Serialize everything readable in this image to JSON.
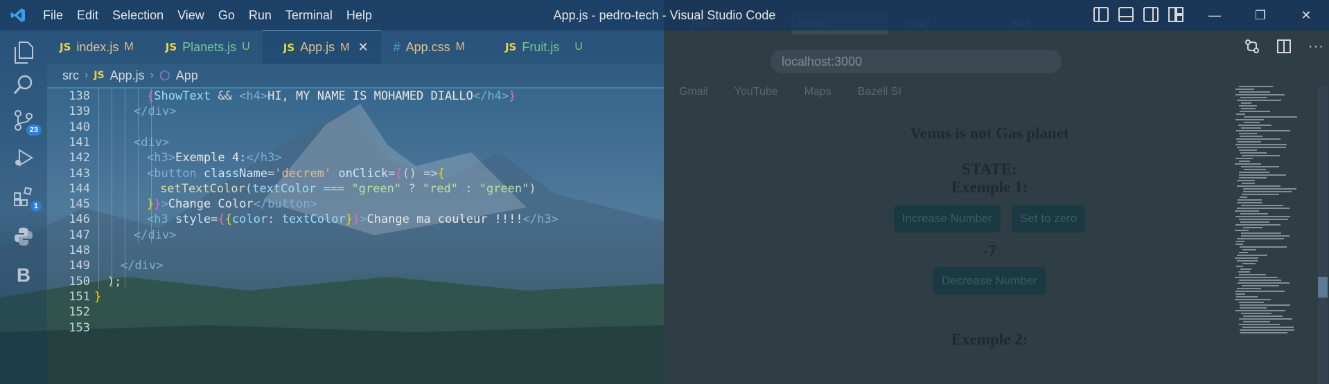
{
  "titlebar": {
    "menu": [
      "File",
      "Edit",
      "Selection",
      "View",
      "Go",
      "Run",
      "Terminal",
      "Help"
    ],
    "title": "App.js - pedro-tech - Visual Studio Code"
  },
  "activity_bar": {
    "source_control_badge": "23",
    "extensions_badge": "1"
  },
  "tabs": [
    {
      "icon": "JS",
      "name": "index.js",
      "status": "M",
      "type": "modified"
    },
    {
      "icon": "JS",
      "name": "Planets.js",
      "status": "U",
      "type": "untracked"
    },
    {
      "icon": "JS",
      "name": "App.js",
      "status": "M",
      "type": "modified-active"
    },
    {
      "icon": "#",
      "name": "App.css",
      "status": "M",
      "type": "modified"
    },
    {
      "icon": "JS",
      "name": "Fruit.js",
      "status": "U",
      "type": "untracked"
    }
  ],
  "breadcrumb": {
    "folder": "src",
    "file_icon": "JS",
    "file": "App.js",
    "symbol": "App"
  },
  "code_lines": [
    {
      "n": "138",
      "indent": 4,
      "tokens": [
        [
          "{",
          "t-pink"
        ],
        [
          "ShowText",
          "t-var"
        ],
        [
          " && ",
          "t-op"
        ],
        [
          "<",
          "t-br"
        ],
        [
          "h4",
          "t-tag"
        ],
        [
          ">",
          "t-br"
        ],
        [
          "HI, MY NAME IS MOHAMED DIALLO",
          "t-text"
        ],
        [
          "</",
          "t-br"
        ],
        [
          "h4",
          "t-tag"
        ],
        [
          ">",
          "t-br"
        ],
        [
          "}",
          "t-pink"
        ]
      ]
    },
    {
      "n": "139",
      "indent": 3,
      "tokens": [
        [
          "</",
          "t-br"
        ],
        [
          "div",
          "t-tag"
        ],
        [
          ">",
          "t-br"
        ]
      ]
    },
    {
      "n": "140",
      "indent": 0,
      "tokens": []
    },
    {
      "n": "141",
      "indent": 3,
      "tokens": [
        [
          "<",
          "t-br"
        ],
        [
          "div",
          "t-tag"
        ],
        [
          ">",
          "t-br"
        ]
      ]
    },
    {
      "n": "142",
      "indent": 4,
      "tokens": [
        [
          "<",
          "t-br"
        ],
        [
          "h3",
          "t-tag"
        ],
        [
          ">",
          "t-br"
        ],
        [
          "Exemple 4:",
          "t-text"
        ],
        [
          "</",
          "t-br"
        ],
        [
          "h3",
          "t-tag"
        ],
        [
          ">",
          "t-br"
        ]
      ]
    },
    {
      "n": "143",
      "indent": 4,
      "tokens": [
        [
          "<",
          "t-br"
        ],
        [
          "button",
          "t-tag"
        ],
        [
          " className",
          "t-attr"
        ],
        [
          "=",
          "t-op"
        ],
        [
          "'decrem'",
          "t-str"
        ],
        [
          " onClick",
          "t-attr"
        ],
        [
          "=",
          "t-op"
        ],
        [
          "{",
          "t-pink"
        ],
        [
          "() =>",
          "t-op"
        ],
        [
          "{",
          "t-gold"
        ]
      ]
    },
    {
      "n": "144",
      "indent": 5,
      "tokens": [
        [
          "setTextColor",
          "t-fn"
        ],
        [
          "(",
          "t-op"
        ],
        [
          "textColor",
          "t-var"
        ],
        [
          " === ",
          "t-op"
        ],
        [
          "\"green\"",
          "t-strg"
        ],
        [
          " ? ",
          "t-op"
        ],
        [
          "\"red\"",
          "t-strg"
        ],
        [
          " : ",
          "t-op"
        ],
        [
          "\"green\"",
          "t-strg"
        ],
        [
          ")",
          "t-op"
        ]
      ]
    },
    {
      "n": "145",
      "indent": 4,
      "tokens": [
        [
          "}",
          "t-gold"
        ],
        [
          "}",
          "t-pink"
        ],
        [
          ">",
          "t-br"
        ],
        [
          "Change Color",
          "t-text"
        ],
        [
          "</",
          "t-br"
        ],
        [
          "button",
          "t-tag"
        ],
        [
          ">",
          "t-br"
        ]
      ]
    },
    {
      "n": "146",
      "indent": 4,
      "tokens": [
        [
          "<",
          "t-br"
        ],
        [
          "h3",
          "t-tag"
        ],
        [
          " style",
          "t-attr"
        ],
        [
          "=",
          "t-op"
        ],
        [
          "{",
          "t-pink"
        ],
        [
          "{",
          "t-gold"
        ],
        [
          "color",
          "t-var"
        ],
        [
          ": ",
          "t-op"
        ],
        [
          "textColor",
          "t-var"
        ],
        [
          "}",
          "t-gold"
        ],
        [
          "}",
          "t-pink"
        ],
        [
          ">",
          "t-br"
        ],
        [
          "Change ma couleur !!!!",
          "t-text"
        ],
        [
          "</",
          "t-br"
        ],
        [
          "h3",
          "t-tag"
        ],
        [
          ">",
          "t-br"
        ]
      ]
    },
    {
      "n": "147",
      "indent": 3,
      "tokens": [
        [
          "</",
          "t-br"
        ],
        [
          "div",
          "t-tag"
        ],
        [
          ">",
          "t-br"
        ]
      ]
    },
    {
      "n": "148",
      "indent": 0,
      "tokens": []
    },
    {
      "n": "149",
      "indent": 2,
      "tokens": [
        [
          "</",
          "t-br"
        ],
        [
          "div",
          "t-tag"
        ],
        [
          ">",
          "t-br"
        ]
      ]
    },
    {
      "n": "150",
      "indent": 1,
      "tokens": [
        [
          ");",
          "t-op"
        ]
      ]
    },
    {
      "n": "151",
      "indent": 0,
      "tokens": [
        [
          "}",
          "t-gold"
        ]
      ]
    },
    {
      "n": "152",
      "indent": 0,
      "tokens": []
    },
    {
      "n": "153",
      "indent": 0,
      "tokens": []
    }
  ],
  "browser": {
    "tabs": [
      "React",
      "React",
      "Toggl",
      "Bolt"
    ],
    "address": "localhost:3000",
    "bookmarks": [
      "Gmail",
      "YouTube",
      "Maps",
      "Bazell SI"
    ],
    "page": {
      "line1": "Venus is not Gas planet",
      "state": "STATE:",
      "exemple1": "Exemple 1:",
      "btn_increase": "Increase Number",
      "btn_zero": "Set to zero",
      "number": "-7",
      "btn_decrease": "Decrease Number",
      "exemple2": "Exemple 2:"
    }
  },
  "colors": {
    "titlebar": "#16365c",
    "js_icon": "#e8d44d",
    "modified": "#e2c08d",
    "untracked": "#73c991",
    "badge": "#2d7fd0"
  }
}
